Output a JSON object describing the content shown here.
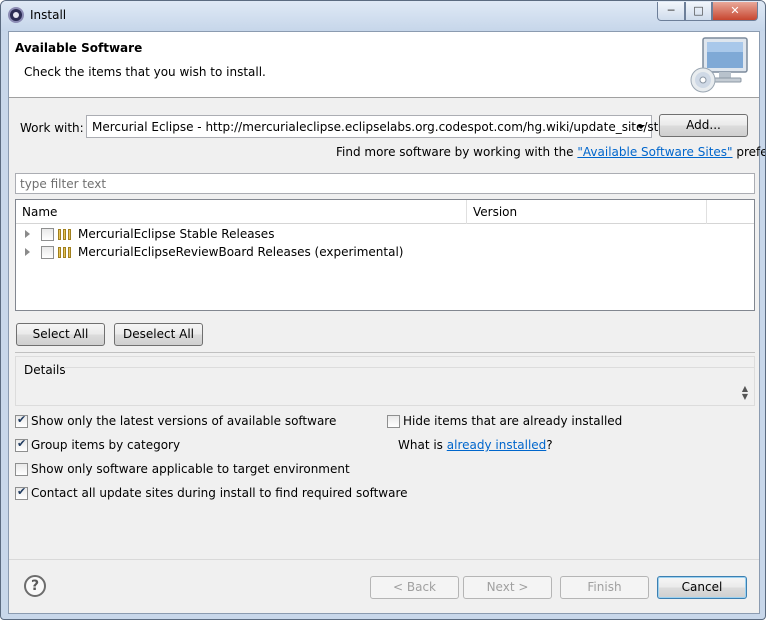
{
  "window": {
    "title": "Install",
    "minimize_glyph": "─",
    "maximize_glyph": "□",
    "close_glyph": "✕"
  },
  "banner": {
    "title": "Available Software",
    "message": "Check the items that you wish to install.",
    "icon": "install-monitor-icon"
  },
  "work_with": {
    "label": "Work with:",
    "value": "Mercurial Eclipse - http://mercurialeclipse.eclipselabs.org.codespot.com/hg.wiki/update_site/stable",
    "add_button": "Add...",
    "hint_prefix": "Find more software by working with the ",
    "hint_link": "\"Available Software Sites\"",
    "hint_suffix": " preferences."
  },
  "filter": {
    "placeholder": "type filter text",
    "value": ""
  },
  "tree": {
    "columns": [
      "Name",
      "Version"
    ],
    "items": [
      {
        "label": "MercurialEclipse Stable Releases",
        "version": "",
        "checked": false,
        "expanded": false
      },
      {
        "label": "MercurialEclipseReviewBoard Releases (experimental)",
        "version": "",
        "checked": false,
        "expanded": false
      }
    ]
  },
  "selection": {
    "select_all": "Select All",
    "deselect_all": "Deselect All"
  },
  "details": {
    "label": "Details"
  },
  "options": {
    "latest_only": {
      "label": "Show only the latest versions of available software",
      "checked": true
    },
    "group_by_category": {
      "label": "Group items by category",
      "checked": true
    },
    "target_env": {
      "label": "Show only software applicable to target environment",
      "checked": false
    },
    "contact_all": {
      "label": "Contact all update sites during install to find required software",
      "checked": true
    },
    "hide_installed": {
      "label": "Hide items that are already installed",
      "checked": false
    },
    "what_is_prefix": "What is ",
    "what_is_link": "already installed",
    "what_is_suffix": "?"
  },
  "footer": {
    "help": "?",
    "back": "< Back",
    "next": "Next >",
    "finish": "Finish",
    "cancel": "Cancel"
  }
}
